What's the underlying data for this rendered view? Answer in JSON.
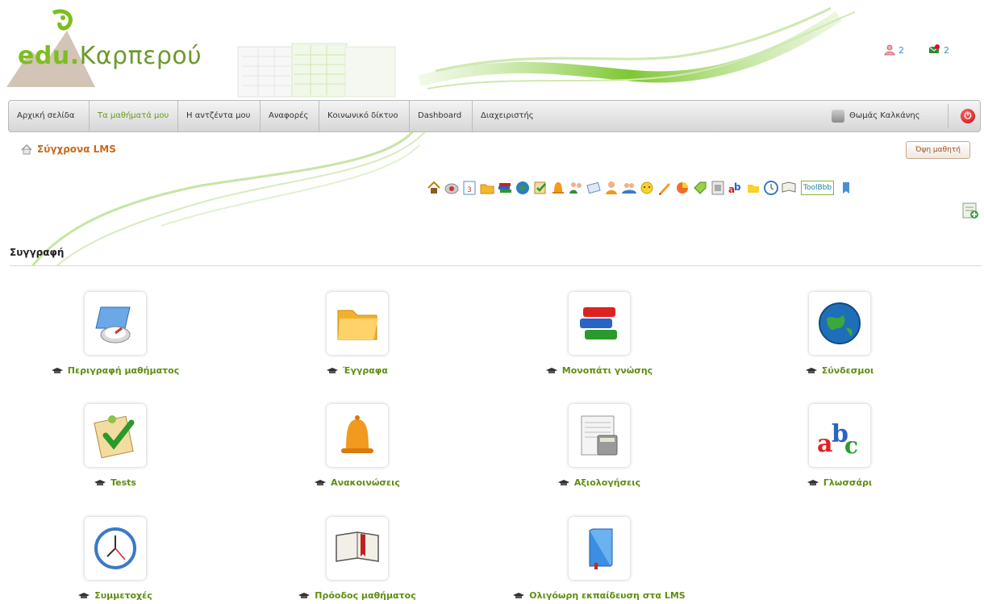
{
  "header": {
    "logo_prefix": "edu",
    "logo_dot": ".",
    "logo_name": "Καρπερού",
    "users_online": "2",
    "messages": "2"
  },
  "nav": {
    "items": [
      {
        "label": "Αρχική σελίδα",
        "active": false
      },
      {
        "label": "Τα μαθήματά μου",
        "active": true
      },
      {
        "label": "Η αντζέντα μου",
        "active": false
      },
      {
        "label": "Αναφορές",
        "active": false
      },
      {
        "label": "Κοινωνικό δίκτυο",
        "active": false
      },
      {
        "label": "Dashboard",
        "active": false
      },
      {
        "label": "Διαχειριστής",
        "active": false
      }
    ],
    "user_name": "Θωμάς Καλκάνης",
    "logout_icon": "power-icon"
  },
  "breadcrumb": {
    "course": "Σύγχρονα LMS",
    "student_view": "Όψη μαθητή"
  },
  "toolbar": {
    "toolbbb_label": "ToolBbb",
    "icons": [
      "home-icon",
      "compass-icon",
      "calendar-icon",
      "folder-icon",
      "books-icon",
      "globe-icon",
      "tests-icon",
      "bell-icon",
      "users-icon",
      "email-icon",
      "group-icon",
      "groups-icon",
      "chat-icon",
      "pencil-icon",
      "pie-icon",
      "tag-icon",
      "gradebook-icon",
      "glossary-icon",
      "notebook-icon",
      "clock-icon",
      "book-icon",
      "toolbbb-icon",
      "bookmark-icon"
    ]
  },
  "section": {
    "title": "Συγγραφή"
  },
  "tools": [
    {
      "label": "Περιγραφή μαθήματος",
      "icon": "course-description-icon"
    },
    {
      "label": "Έγγραφα",
      "icon": "folder-icon"
    },
    {
      "label": "Μονοπάτι γνώσης",
      "icon": "books-icon"
    },
    {
      "label": "Σύνδεσμοι",
      "icon": "globe-icon"
    },
    {
      "label": "Tests",
      "icon": "tests-icon"
    },
    {
      "label": "Ανακοινώσεις",
      "icon": "bell-icon"
    },
    {
      "label": "Αξιολογήσεις",
      "icon": "gradebook-icon"
    },
    {
      "label": "Γλωσσάρι",
      "icon": "abc-icon"
    },
    {
      "label": "Συμμετοχές",
      "icon": "clock-icon"
    },
    {
      "label": "Πρόοδος μαθήματος",
      "icon": "open-book-icon"
    },
    {
      "label": "Ολιγόωρη εκπαίδευση στα LMS",
      "icon": "blue-book-icon"
    }
  ],
  "colors": {
    "accent_green": "#6a9a17",
    "tool_label": "#5f8d12",
    "breadcrumb": "#c8691c"
  }
}
